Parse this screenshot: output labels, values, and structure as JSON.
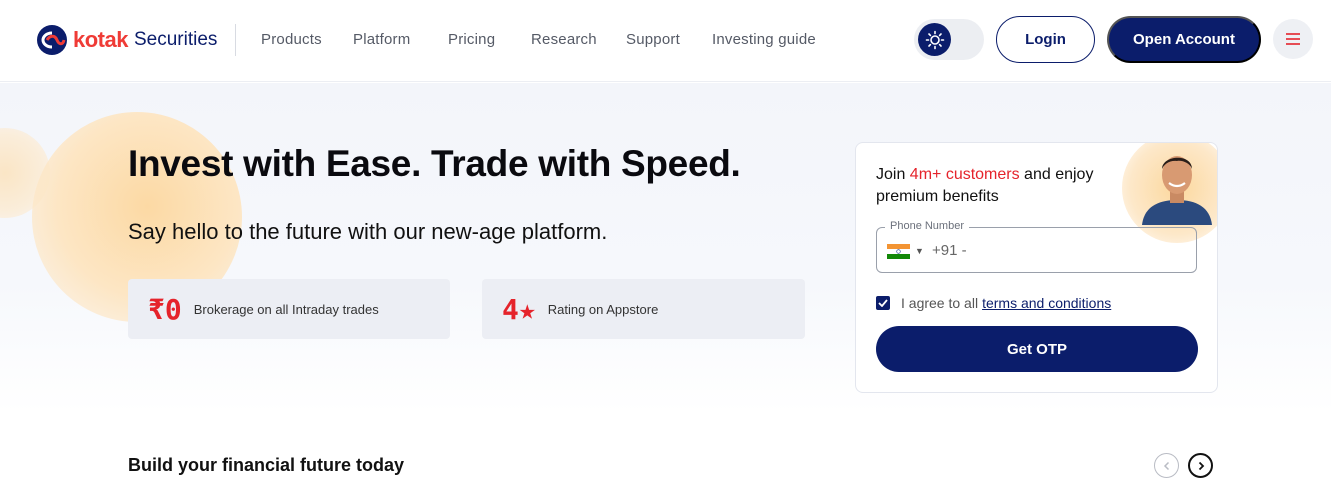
{
  "brand": {
    "name": "kotak",
    "suffix": "Securities",
    "accent": "#ef3b36",
    "primary": "#0b1d6b"
  },
  "nav": [
    {
      "label": "Products"
    },
    {
      "label": "Platform"
    },
    {
      "label": "Pricing"
    },
    {
      "label": "Research"
    },
    {
      "label": "Support"
    },
    {
      "label": "Investing guide"
    }
  ],
  "header": {
    "theme_icon": "sun-icon",
    "login_label": "Login",
    "open_account_label": "Open Account",
    "menu_icon": "hamburger-menu-icon"
  },
  "hero": {
    "title": "Invest with Ease. Trade with Speed.",
    "subtitle": "Say hello to the future with our new-age platform.",
    "stats": [
      {
        "value": "₹0",
        "label": "Brokerage on all Intraday trades"
      },
      {
        "value": "4★",
        "label": "Rating on Appstore"
      }
    ]
  },
  "signup": {
    "headline_prefix": "Join ",
    "headline_highlight": "4m+ customers",
    "headline_suffix": " and enjoy premium benefits",
    "phone_label": "Phone Number",
    "phone_prefix": "+91 -",
    "agree_text": "I agree to all",
    "terms_link": "terms and conditions",
    "agree_checked": true,
    "submit_label": "Get OTP"
  },
  "section": {
    "title": "Build your financial future today",
    "prev_icon": "chevron-left-icon",
    "next_icon": "chevron-right-icon"
  }
}
